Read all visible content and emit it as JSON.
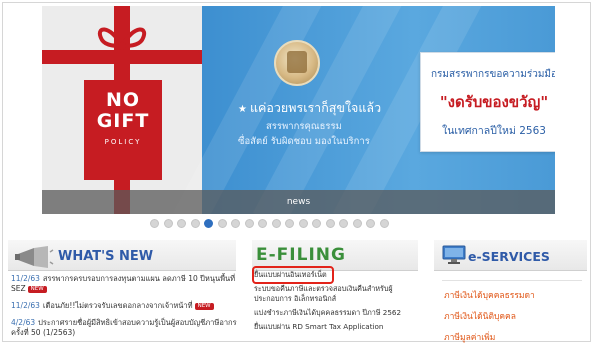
{
  "banner": {
    "gift_box": {
      "line1": "NO",
      "line2": "GIFT",
      "line3": "POLICY"
    },
    "slogan": "แค่อวยพรเราก็สุขใจแล้ว",
    "line2": "สรรพากรคุณธรรม",
    "line3": "ซื่อสัตย์ รับผิดชอบ มองในบริการ",
    "cta": {
      "line1": "กรมสรรพากรขอความร่วมมือ",
      "line2": "\"งดรับของขวัญ\"",
      "line3": "ในเทศกาลปีใหม่ 2563"
    },
    "caption": "news",
    "colors": {
      "red": "#c61c22",
      "blue": "#4a9ad6"
    }
  },
  "carousel": {
    "dot_count": 18,
    "active_index": 4
  },
  "whats_new": {
    "title": "WHAT'S NEW",
    "items": [
      {
        "date": "11/2/63",
        "text": "สรรพากรครบรอบการลงทุนตามแผน ลดภาษี 10 ปีหนุนพื้นที่ SEZ",
        "badge": "NEW"
      },
      {
        "date": "11/2/63",
        "text": "เตือนภัย!!ไม่ตรวจรับเลขดอกลางจากเจ้าหน้าที่",
        "badge": "NEW"
      },
      {
        "date": "4/2/63",
        "text": "ประกาศรายชื่อผู้มีสิทธิเข้าสอบความรู้เป็นผู้สอบบัญชีภาษีอากร ครั้งที่ 50 (1/2563)",
        "badge": ""
      }
    ]
  },
  "efiling": {
    "title": "E-FILING",
    "items": [
      "ยื่นแบบผ่านอินเทอร์เน็ต",
      "ระบบขอคืนภาษีและตรวจสอบเงินคืนสำหรับผู้ประกอบการ อิเล็กทรอนิกส์",
      "แบ่งชำระภาษีเงินได้บุคคลธรรมดา ปีภาษี 2562",
      "ยื่นแบบผ่าน RD Smart Tax Application"
    ]
  },
  "eservices": {
    "title": "e-SERVICES",
    "items": [
      "ภาษีเงินได้บุคคลธรรมดา",
      "ภาษีเงินได้นิติบุคคล",
      "ภาษีมูลค่าเพิ่ม"
    ]
  }
}
